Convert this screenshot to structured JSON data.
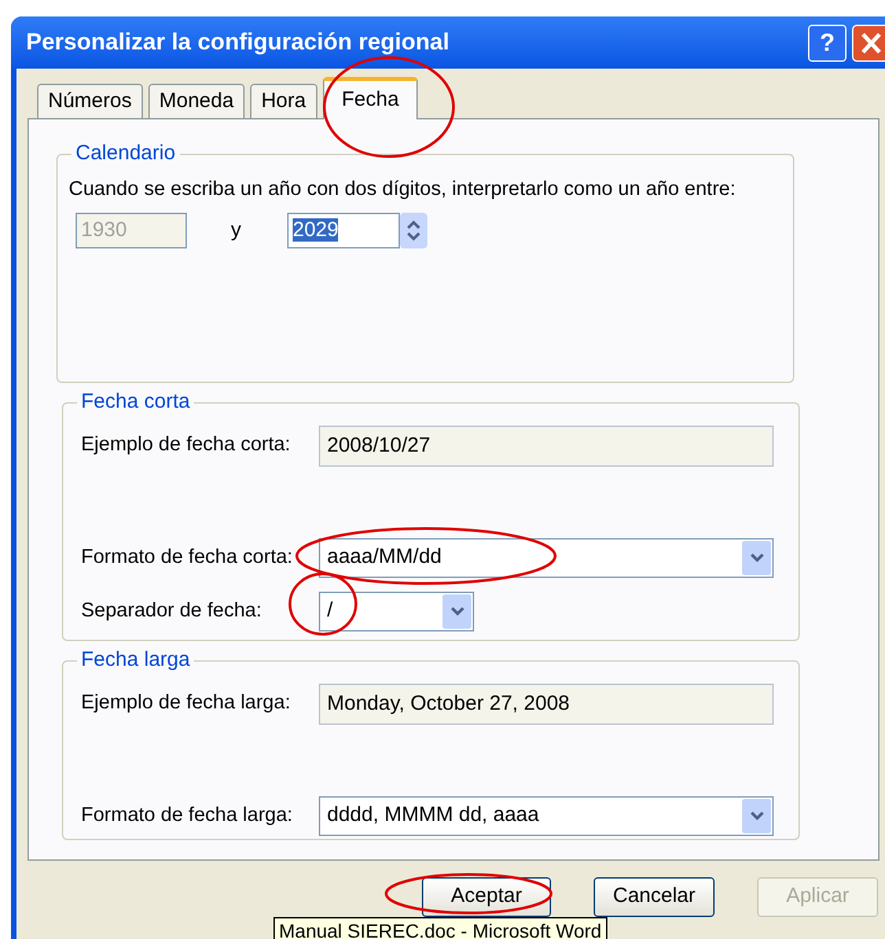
{
  "window": {
    "title": "Personalizar la configuración regional",
    "help_label": "?"
  },
  "tabs": [
    {
      "label": "Números",
      "selected": false
    },
    {
      "label": "Moneda",
      "selected": false
    },
    {
      "label": "Hora",
      "selected": false
    },
    {
      "label": "Fecha",
      "selected": true
    }
  ],
  "calendar": {
    "title": "Calendario",
    "description": "Cuando se escriba un año con dos dígitos, interpretarlo como un año entre:",
    "from": {
      "value": "1930",
      "disabled": true
    },
    "connector": "y",
    "to": {
      "value": "2029",
      "text_selected": true
    }
  },
  "short_date": {
    "title": "Fecha corta",
    "rows": [
      {
        "kind": "display",
        "label": "Ejemplo de fecha corta:",
        "value": "2008/10/27"
      },
      {
        "kind": "combo",
        "label": "Formato de fecha corta:",
        "value": "aaaa/MM/dd"
      },
      {
        "kind": "small_combo",
        "label": "Separador de fecha:",
        "value": "/"
      }
    ]
  },
  "long_date": {
    "title": "Fecha larga",
    "rows": [
      {
        "kind": "display",
        "label": "Ejemplo de fecha larga:",
        "value": "Monday, October 27, 2008"
      },
      {
        "kind": "combo",
        "label": "Formato de fecha larga:",
        "value": "dddd, MMMM dd, aaaa"
      }
    ]
  },
  "buttons": [
    {
      "label": "Aceptar",
      "disabled": false
    },
    {
      "label": "Cancelar",
      "disabled": false
    },
    {
      "label": "Aplicar",
      "disabled": true
    }
  ],
  "tooltip": {
    "text": "Manual SIEREC.doc - Microsoft Word"
  }
}
